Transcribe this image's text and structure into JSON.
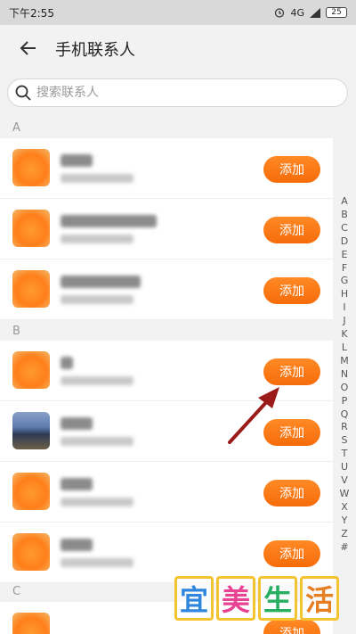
{
  "status_bar": {
    "time": "下午2:55",
    "network": "4G",
    "battery": "25"
  },
  "header": {
    "title": "手机联系人"
  },
  "search": {
    "placeholder": "搜索联系人"
  },
  "sections": [
    {
      "letter": "A"
    },
    {
      "letter": "B"
    },
    {
      "letter": "C"
    }
  ],
  "contacts": [
    {
      "add_label": "添加"
    },
    {
      "add_label": "添加"
    },
    {
      "add_label": "添加"
    },
    {
      "add_label": "添加"
    },
    {
      "add_label": "添加"
    },
    {
      "add_label": "添加"
    },
    {
      "add_label": "添加"
    },
    {
      "add_label": "添加"
    }
  ],
  "index_letters": [
    "A",
    "B",
    "C",
    "D",
    "E",
    "F",
    "G",
    "H",
    "I",
    "J",
    "K",
    "L",
    "M",
    "N",
    "O",
    "P",
    "Q",
    "R",
    "S",
    "T",
    "U",
    "V",
    "W",
    "X",
    "Y",
    "Z",
    "#"
  ],
  "watermark": [
    "宜",
    "美",
    "生",
    "活"
  ],
  "colors": {
    "accent": "#f57a14",
    "arrow": "#9b1a1a",
    "watermark_border": "#f4c430"
  },
  "icons": {
    "back": "arrow-left-icon",
    "search": "search-icon",
    "status": [
      "alarm-icon",
      "signal-icon",
      "battery-icon"
    ]
  }
}
